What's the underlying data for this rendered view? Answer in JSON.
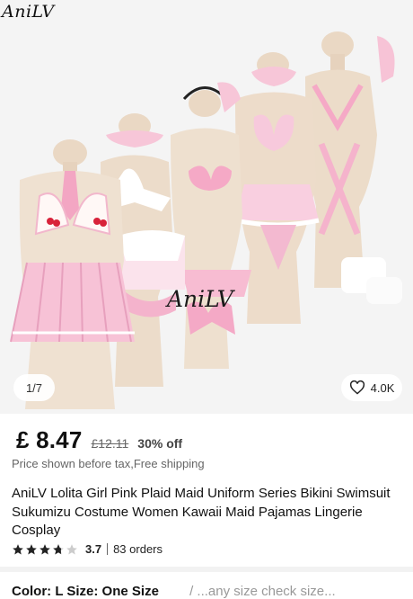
{
  "gallery": {
    "brand_logo": "AniLV",
    "watermark": "AniLV",
    "counter": "1/7",
    "likes": "4.0K",
    "icons": {
      "like": "heart-outline-icon"
    }
  },
  "pricing": {
    "price": "£ 8.47",
    "original_price": "£12.11",
    "discount": "30% off",
    "note": "Price shown before tax,Free shipping"
  },
  "product": {
    "title": "AniLV Lolita Girl Pink Plaid Maid Uniform Series Bikini Swimsuit Sukumizu Costume Women Kawaii Maid Pajamas Lingerie Cosplay",
    "rating": "3.7",
    "rating_stars": 3.7,
    "orders": "83 orders"
  },
  "variants": {
    "label": "Color: L Size: One Size",
    "more": "/ ...any size check size..."
  },
  "colors": {
    "pink": "#f4c6d8",
    "lace": "#ffffff",
    "mannequin": "#ead8c4",
    "star": "#222222"
  }
}
